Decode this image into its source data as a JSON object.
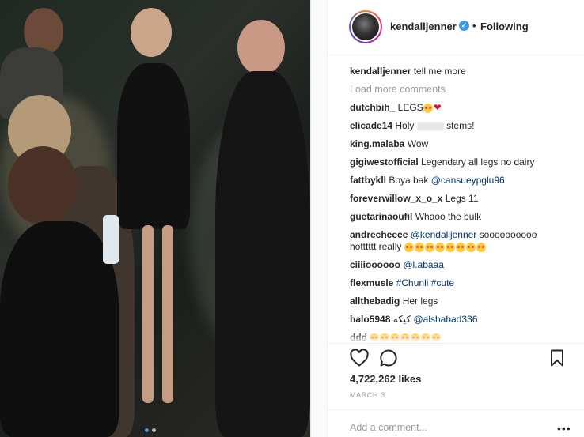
{
  "header": {
    "username": "kendalljenner",
    "separator": "•",
    "follow_status": "Following"
  },
  "caption": {
    "user": "kendalljenner",
    "text": "tell me more"
  },
  "load_more": "Load more comments",
  "comments": [
    {
      "user": "dutchbih_",
      "text": "LEGS"
    },
    {
      "user": "elicade14",
      "text_before": "Holy",
      "text_after": "stems!"
    },
    {
      "user": "king.malaba",
      "text": "Wow"
    },
    {
      "user": "gigiwestofficial",
      "text": "Legendary all legs no dairy"
    },
    {
      "user": "fattbykll",
      "text": "Boya bak",
      "mention": "@cansueypglu96"
    },
    {
      "user": "foreverwillow_x_o_x",
      "text": "Legs 11"
    },
    {
      "user": "guetarinaoufil",
      "text": "Whaoo the bulk"
    },
    {
      "user": "andrecheeee",
      "mention": "@kendalljenner",
      "text": "soooooooooo",
      "text2": "hotttttt really"
    },
    {
      "user": "ciiiioooooo",
      "mention": "@l.abaaa"
    },
    {
      "user": "flexmusle",
      "mention": "#Chunli #cute"
    },
    {
      "user": "allthebadig",
      "text": "Her legs"
    },
    {
      "user": "halo5948",
      "text": "کیکه",
      "mention": "@alshahad336"
    },
    {
      "user": "ddd"
    }
  ],
  "likes": "4,722,262 likes",
  "date": "MARCH 3",
  "add_comment_placeholder": "Add a comment...",
  "more_options": "•••",
  "icons": {
    "verified": "verified-badge-icon",
    "like": "heart-outline-icon",
    "comment": "comment-bubble-icon",
    "save": "bookmark-icon"
  },
  "colors": {
    "link": "#003569",
    "verified": "#3897f0",
    "muted": "#999999"
  }
}
